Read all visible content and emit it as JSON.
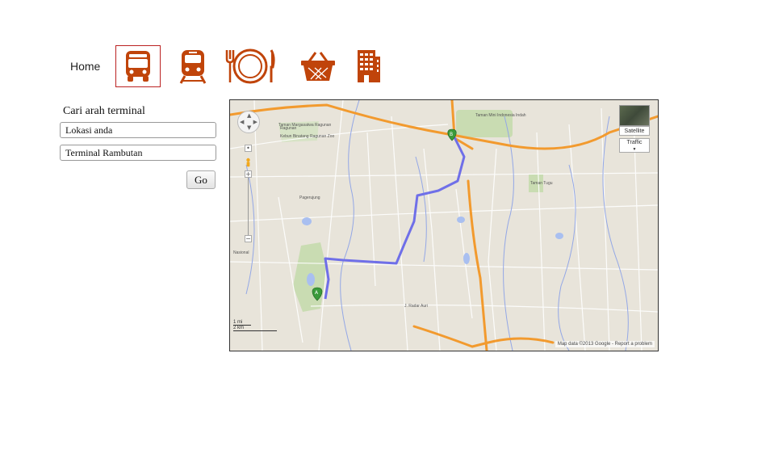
{
  "nav": {
    "home_label": "Home",
    "icons": [
      "bus-icon",
      "train-icon",
      "restaurant-icon",
      "shopping-basket-icon",
      "hotel-icon"
    ],
    "active": "bus-icon",
    "accent_color": "#c0440a"
  },
  "form": {
    "title": "Cari arah terminal",
    "origin_value": "Lokasi anda",
    "destination_value": "Terminal Rambutan",
    "go_label": "Go"
  },
  "map": {
    "satellite_label": "Satellite",
    "traffic_label": "Traffic",
    "scale_mi": "1 mi",
    "scale_km": "2 km",
    "copyright": "Map data ©2013 Google",
    "report_label": "Report a problem",
    "marker_a": "A",
    "marker_b": "B",
    "place_labels": [
      "Taman Mini Indonesia Indah",
      "Ragunan",
      "Pagerujung",
      "Kebun Binatang Ragunan Zoo",
      "J. Radar Auri",
      "Taman Margasatwa Ragunan",
      "Nasional",
      "Taman Tugu"
    ],
    "route_color": "#6f6fe8",
    "highway_color": "#f29a2e"
  }
}
